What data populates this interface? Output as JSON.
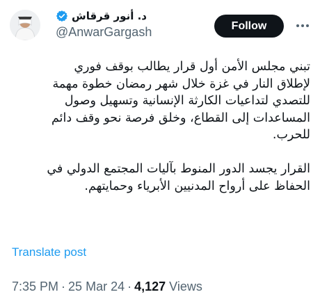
{
  "author": {
    "display_name": "د. أنور قرقاش",
    "handle": "@AnwarGargash",
    "verified": true,
    "verified_color": "#1d9bf0",
    "avatar_icon": "profile-photo"
  },
  "actions": {
    "follow_label": "Follow",
    "more_icon": "more-horizontal-icon"
  },
  "tweet": {
    "lines": [
      "تبني مجلس الأمن أول قرار يطالب بوقف فوري",
      "لإطلاق النار في غزة خلال شهر رمضان خطوة مهمة",
      "للتصدي لتداعيات الكارثة الإنسانية وتسهيل وصول",
      "المساعدات إلى القطاع، وخلق فرصة نحو وقف دائم",
      "للحرب."
    ],
    "lines_2": [
      "القرار يجسد الدور المنوط بآليات المجتمع الدولي في",
      "الحفاظ على أرواح المدنيين الأبرياء وحمايتهم."
    ],
    "translate_label": "Translate post"
  },
  "meta": {
    "time": "7:35 PM",
    "separator": "·",
    "date": "25 Mar 24",
    "views_count": "4,127",
    "views_label": "Views"
  }
}
